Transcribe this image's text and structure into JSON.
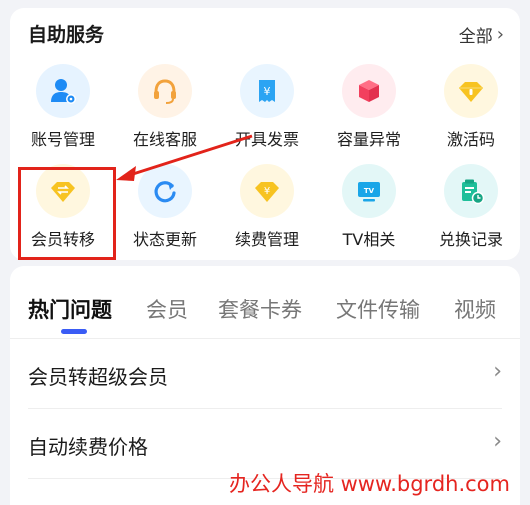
{
  "services": {
    "title": "自助服务",
    "all_label": "全部",
    "row1": [
      {
        "label": "账号管理",
        "icon": "account-manage-icon"
      },
      {
        "label": "在线客服",
        "icon": "headset-icon"
      },
      {
        "label": "开具发票",
        "icon": "invoice-icon"
      },
      {
        "label": "容量异常",
        "icon": "capacity-cube-icon"
      },
      {
        "label": "激活码",
        "icon": "diamond-icon"
      }
    ],
    "row2": [
      {
        "label": "会员转移",
        "icon": "transfer-diamond-icon"
      },
      {
        "label": "状态更新",
        "icon": "refresh-icon"
      },
      {
        "label": "续费管理",
        "icon": "renew-diamond-icon"
      },
      {
        "label": "TV相关",
        "icon": "tv-icon"
      },
      {
        "label": "兑换记录",
        "icon": "redeem-record-icon"
      }
    ]
  },
  "faq": {
    "tabs": [
      "热门问题",
      "会员",
      "套餐卡券",
      "文件传输",
      "视频"
    ],
    "active_tab": "热门问题",
    "items": [
      {
        "question": "会员转超级会员"
      },
      {
        "question": "自动续费价格"
      }
    ]
  },
  "watermark": "办公人导航 www.bgrdh.com",
  "colors": {
    "accent": "#3a5cf5",
    "highlight": "#e2231a",
    "watermark": "#e52520"
  }
}
